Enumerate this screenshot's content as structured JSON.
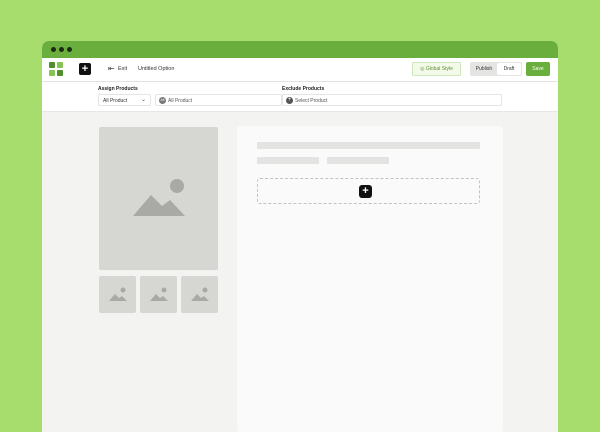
{
  "window": {
    "controls": [
      "close-dot",
      "minimize-dot",
      "maximize-dot"
    ]
  },
  "toolbar": {
    "add_label": "+",
    "exit_label": "Exit",
    "title": "Untitled Option",
    "global_style_label": "Global Style",
    "publish_label": "Publish",
    "draft_label": "Draft",
    "active_mode": "Draft",
    "save_label": "Save"
  },
  "filters": {
    "assign_label": "Assign Products",
    "assign_select_value": "All Product",
    "assign_chip_icon": "All",
    "assign_chip_text": "All Product",
    "exclude_label": "Exclude Products",
    "exclude_chip_text": "Select Product"
  },
  "canvas": {
    "add_block_label": "+"
  },
  "icons": {
    "logo": "app-logo",
    "exit": "exit-icon",
    "global_style": "palette-icon",
    "chevron": "chevron-down-icon",
    "placeholder": "image-placeholder-icon"
  },
  "colors": {
    "brand_green": "#6aaf3d",
    "background_green": "#a6dd6c",
    "placeholder_gray": "#d6d7d3"
  }
}
